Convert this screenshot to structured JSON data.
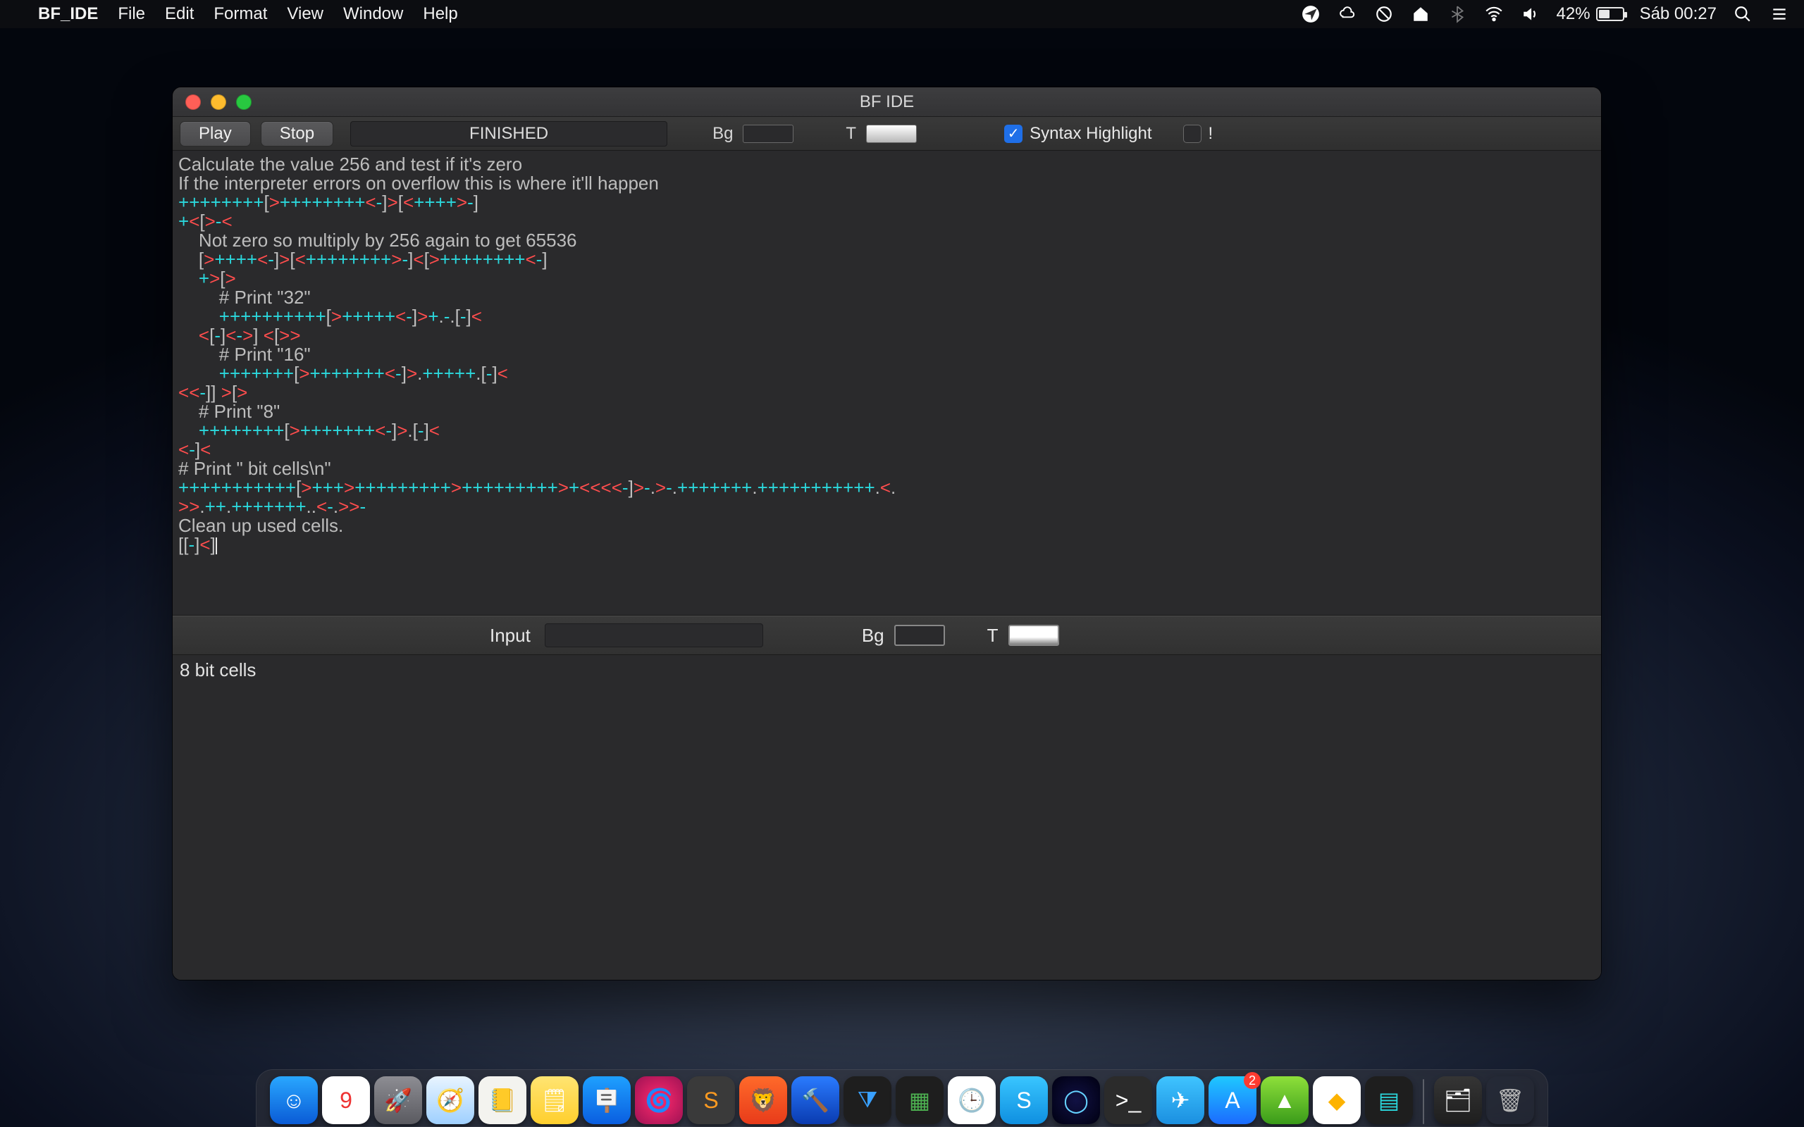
{
  "menubar": {
    "app_name": "BF_IDE",
    "items": [
      "File",
      "Edit",
      "Format",
      "View",
      "Window",
      "Help"
    ],
    "battery_pct": "42%",
    "clock": "Sáb 00:27"
  },
  "window": {
    "title": "BF IDE",
    "play_label": "Play",
    "stop_label": "Stop",
    "status": "FINISHED",
    "bg_label": "Bg",
    "t_label": "T",
    "syntax_label": "Syntax Highlight",
    "syntax_checked": true,
    "bang_label": "!",
    "bang_checked": false
  },
  "code": {
    "l1": "Calculate the value 256 and test if it's zero",
    "l2": "If the interpreter errors on overflow this is where it'll happen",
    "l3": "++++++++[>++++++++<-]>[<++++>-]",
    "l4": "+<[>-<",
    "l5": "    Not zero so multiply by 256 again to get 65536",
    "l6": "    [>++++<-]>[<++++++++>-]<[>++++++++<-]",
    "l7": "    +>[>",
    "l8": "        # Print \"32\"",
    "l9": "        ++++++++++[>+++++<-]>+.-.[-]<",
    "l10": "    <[-]<->] <[>>",
    "l11": "        # Print \"16\"",
    "l12": "        +++++++[>+++++++<-]>.+++++.[-]<",
    "l13": "<<-]] >[>",
    "l14": "    # Print \"8\"",
    "l15": "    ++++++++[>+++++++<-]>.[-]<",
    "l16": "<-]<",
    "l17": "# Print \" bit cells\\n\"",
    "l18": "+++++++++++[>+++>+++++++++>+++++++++>+<<<<-]>-.>-.+++++++.+++++++++++.<.",
    "l19": ">>.++.+++++++..<-.>>-",
    "l20": "Clean up used cells.",
    "l21": "[[-]<]"
  },
  "mid": {
    "input_label": "Input",
    "bg_label": "Bg",
    "t_label": "T"
  },
  "output": {
    "text": "8 bit cells"
  },
  "dock": {
    "apps": [
      {
        "name": "finder",
        "bg": "linear-gradient(#29a7ff,#0a5bd6)",
        "glyph": "☺"
      },
      {
        "name": "calendar",
        "bg": "#ffffff",
        "glyph": "9",
        "color": "#e33"
      },
      {
        "name": "launchpad",
        "bg": "linear-gradient(#8d8d93,#5a5a60)",
        "glyph": "🚀"
      },
      {
        "name": "safari",
        "bg": "linear-gradient(#e8f4ff,#9fd0ff)",
        "glyph": "🧭"
      },
      {
        "name": "reminders",
        "bg": "#f3f3ef",
        "glyph": "📒"
      },
      {
        "name": "notes",
        "bg": "linear-gradient(#ffe472,#ffcf2e)",
        "glyph": "🗒"
      },
      {
        "name": "keynote",
        "bg": "linear-gradient(#1ea0ff,#0a5ee0)",
        "glyph": "🪧"
      },
      {
        "name": "firefox",
        "bg": "radial-gradient(circle at 50% 50%,#ff2a6d,#9e1254)",
        "glyph": "🌀"
      },
      {
        "name": "sublime",
        "bg": "#3a3a3a",
        "glyph": "S",
        "color": "#ff9b21"
      },
      {
        "name": "brave",
        "bg": "linear-gradient(#ff6a2a,#e83b1a)",
        "glyph": "🦁"
      },
      {
        "name": "xcode",
        "bg": "linear-gradient(#2a7bff,#0a3bb0)",
        "glyph": "🔨"
      },
      {
        "name": "vscode",
        "bg": "#1e1e1e",
        "glyph": "⧩",
        "color": "#39a0ff"
      },
      {
        "name": "activity",
        "bg": "#1e1e1e",
        "glyph": "▦",
        "color": "#4caf50"
      },
      {
        "name": "clock",
        "bg": "#ffffff",
        "glyph": "🕒",
        "color": "#333"
      },
      {
        "name": "skype",
        "bg": "linear-gradient(#39c6ff,#0f8fe0)",
        "glyph": "S"
      },
      {
        "name": "opera",
        "bg": "radial-gradient(circle,#114,#001)",
        "glyph": "◯",
        "color": "#65d2ff"
      },
      {
        "name": "terminal",
        "bg": "#2b2b2b",
        "glyph": ">_"
      },
      {
        "name": "telegram",
        "bg": "linear-gradient(#3fc4ff,#1b8fe0)",
        "glyph": "✈"
      },
      {
        "name": "appstore",
        "bg": "linear-gradient(#1fc8ff,#1b6bff)",
        "glyph": "A",
        "badge": "2"
      },
      {
        "name": "androidstudio",
        "bg": "linear-gradient(#8ee03a,#3a9b1a)",
        "glyph": "▲"
      },
      {
        "name": "sketch",
        "bg": "#ffffff",
        "glyph": "◆",
        "color": "#fdb300"
      },
      {
        "name": "monitor",
        "bg": "#1e1e1e",
        "glyph": "▤",
        "color": "#2bd8dd"
      }
    ],
    "right": [
      {
        "name": "folder",
        "bg": "linear-gradient(#353535,#1e1e1e)",
        "glyph": "🗂"
      },
      {
        "name": "trash",
        "bg": "transparent",
        "glyph": "🗑",
        "color": "#b8b8b8"
      }
    ]
  }
}
